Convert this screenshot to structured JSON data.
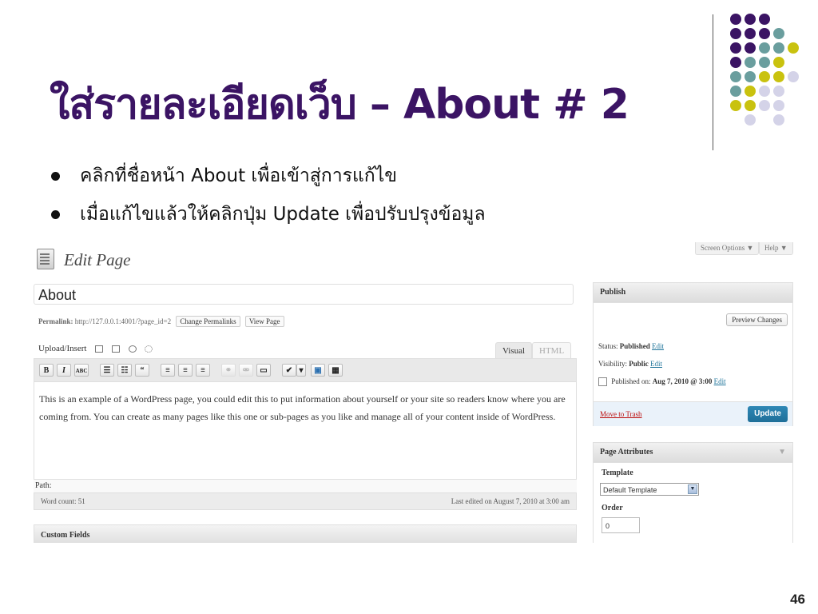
{
  "slide": {
    "title": "ใส่รายละเอียดเว็บ – About # 2",
    "bullets": [
      "คลิกที่ชื่อหน้า About เพื่อเข้าสู่การแก้ไข",
      "เมื่อแก้ไขแล้วให้คลิกปุ่ม Update เพื่อปรับปรุงข้อมูล"
    ],
    "page_number": "46",
    "colors": {
      "title": "#3b1464",
      "dot_purple": "#3b1464",
      "dot_teal": "#6a9e9e",
      "dot_olive": "#c9c20f",
      "dot_lavender": "#d4d3e8"
    }
  },
  "wp": {
    "heading": "Edit Page",
    "screen_options": "Screen Options ▼",
    "help": "Help ▼",
    "post_title": "About",
    "permalink_label": "Permalink:",
    "permalink_url": "http://127.0.0.1:4001/?page_id=2",
    "change_permalinks": "Change Permalinks",
    "view_page": "View Page",
    "upload_insert": "Upload/Insert",
    "tab_visual": "Visual",
    "tab_html": "HTML",
    "toolbar": {
      "bold": "B",
      "italic": "I",
      "strike": "ABC",
      "bullet_list": "☰",
      "number_list": "☷",
      "quote": "“",
      "align_left": "≡",
      "align_center": "≡",
      "align_right": "≡",
      "link": "⚭",
      "unlink": "⚮",
      "more": "▭",
      "spell": "✔",
      "dropdown": "▾",
      "fullscreen": "▣",
      "kitchen": "▦"
    },
    "content": "This is an example of a WordPress page, you could edit this to put information about yourself or your site so readers know where you are coming from. You can create as many pages like this one or sub-pages as you like and manage all of your content inside of WordPress.",
    "path": "Path:",
    "word_count": "Word count: 51",
    "last_edited": "Last edited on August 7, 2010 at 3:00 am",
    "custom_fields": "Custom Fields",
    "publish": {
      "title": "Publish",
      "preview": "Preview Changes",
      "status_label": "Status:",
      "status_value": "Published",
      "visibility_label": "Visibility:",
      "visibility_value": "Public",
      "published_on_label": "Published on:",
      "published_on_value": "Aug 7, 2010 @ 3:00",
      "edit": "Edit",
      "trash": "Move to Trash",
      "update": "Update"
    },
    "attributes": {
      "title": "Page Attributes",
      "template_label": "Template",
      "template_value": "Default Template",
      "order_label": "Order",
      "order_value": "0"
    }
  }
}
